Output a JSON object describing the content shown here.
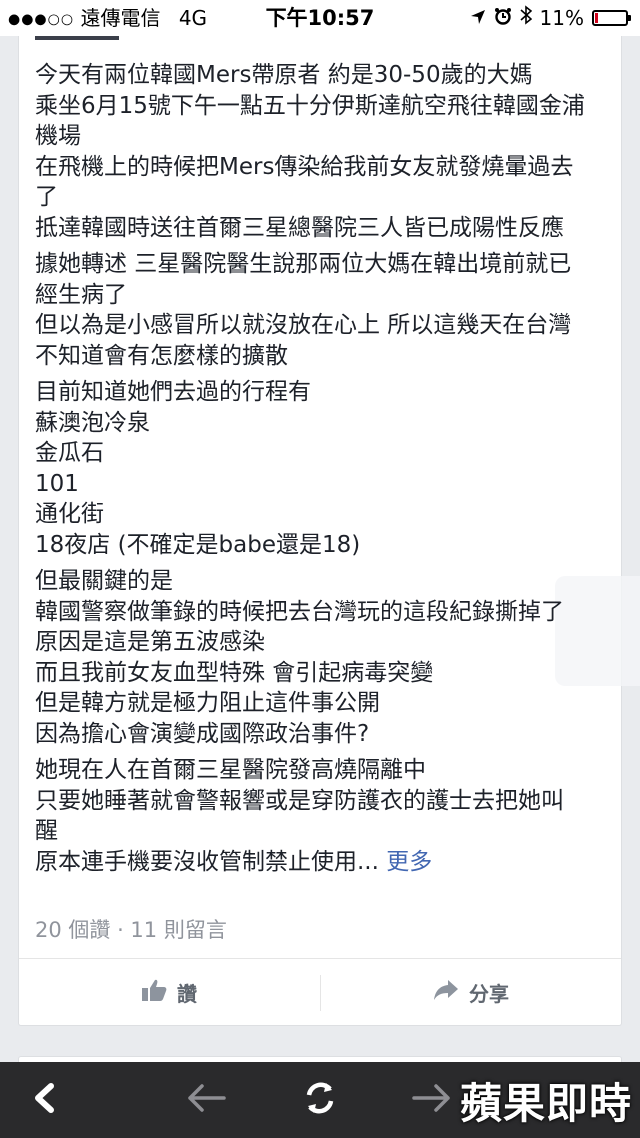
{
  "status_bar": {
    "carrier": "遠傳電信",
    "network": "4G",
    "time": "下午10:57",
    "battery": "11%",
    "battery_level": 0.11
  },
  "post": {
    "paragraphs": [
      [
        "今天有兩位韓國Mers帶原者 約是30-50歲的大媽",
        "乘坐6月15號下午一點五十分伊斯達航空飛往韓國金浦",
        "機場",
        "在飛機上的時候把Mers傳染給我前女友就發燒暈過去",
        "了",
        "抵達韓國時送往首爾三星總醫院三人皆已成陽性反應"
      ],
      [
        "據她轉述 三星醫院醫生說那兩位大媽在韓出境前就已",
        "經生病了",
        "但以為是小感冒所以就沒放在心上 所以這幾天在台灣",
        "不知道會有怎麼樣的擴散"
      ],
      [
        "目前知道她們去過的行程有",
        "蘇澳泡冷泉",
        "金瓜石",
        "101",
        "通化街",
        "18夜店 (不確定是babe還是18)"
      ],
      [
        "但最關鍵的是",
        "韓國警察做筆錄的時候把去台灣玩的這段紀錄撕掉了",
        "原因是這是第五波感染",
        "而且我前女友血型特殊 會引起病毒突變",
        "但是韓方就是極力阻止這件事公開",
        "因為擔心會演變成國際政治事件?"
      ],
      [
        "她現在人在首爾三星醫院發高燒隔離中",
        "只要她睡著就會警報響或是穿防護衣的護士去把她叫",
        "醒"
      ]
    ],
    "last_line": "原本連手機要沒收管制禁止使用...",
    "more_link": "更多",
    "counts": "20 個讚 · 11 則留言",
    "like_label": "讚",
    "share_label": "分享"
  },
  "watermark": "蘋果即時",
  "colors": {
    "link": "#4267b2",
    "muted": "#90949c",
    "toolbar": "#2a2a2c"
  }
}
